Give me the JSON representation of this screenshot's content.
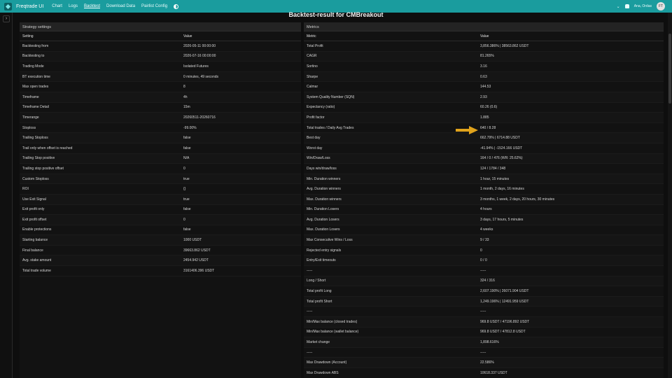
{
  "navbar": {
    "brand": "Freqtrade UI",
    "links": [
      "Chart",
      "Logs",
      "Backtest",
      "Download Data",
      "Pairlist Config"
    ],
    "active_index": 2,
    "user_name": "Ana, Ordas",
    "avatar_initials": "FT"
  },
  "page": {
    "title": "Backtest-result for CMBreakout"
  },
  "strategy": {
    "header": "Strategy settings",
    "col_setting": "Setting",
    "col_value": "Value",
    "rows": [
      [
        "Backtesting from",
        "2026-05-11 00:00:00"
      ],
      [
        "Backtesting to",
        "2026-07-16 00:00:00"
      ],
      [
        "Trading Mode",
        "Isolated Futures"
      ],
      [
        "BT execution time",
        "0 minutes, 49 seconds"
      ],
      [
        "Max open trades",
        "8"
      ],
      [
        "Timeframe",
        "4h"
      ],
      [
        "Timeframe Detail",
        "15m"
      ],
      [
        "Timerange",
        "20260511-20260716"
      ],
      [
        "Stoploss",
        "-99.00%"
      ],
      [
        "Trailing Stoploss",
        "false"
      ],
      [
        "Trail only when offset is reached",
        "false"
      ],
      [
        "Trailing Stop positive",
        "N/A"
      ],
      [
        "Trailing stop positive offset",
        "0"
      ],
      [
        "Custom Stoploss",
        "true"
      ],
      [
        "ROI",
        "{}"
      ],
      [
        "Use Exit Signal",
        "true"
      ],
      [
        "Exit profit only",
        "false"
      ],
      [
        "Exit profit offset",
        "0"
      ],
      [
        "Enable protections",
        "false"
      ],
      [
        "Starting balance",
        "1000 USDT"
      ],
      [
        "Final balance",
        "39663.862 USDT"
      ],
      [
        "Avg. stake amount",
        "2454.942 USDT"
      ],
      [
        "Total trade volume",
        "3161406.396 USDT"
      ]
    ]
  },
  "metrics": {
    "header": "Metrics",
    "col_metric": "Metric",
    "col_value": "Value",
    "rows": [
      [
        "Total Profit",
        "3,856.386% | 38563.862 USDT"
      ],
      [
        "CAGR",
        "81.265%"
      ],
      [
        "Sortino",
        "3.16"
      ],
      [
        "Sharpe",
        "0.63"
      ],
      [
        "Calmar",
        "144.53"
      ],
      [
        "System Quality Number (SQN)",
        "2.93"
      ],
      [
        "Expectancy (ratio)",
        "60.26 (0.6)"
      ],
      [
        "Profit factor",
        "1.885"
      ],
      [
        "Total trades / Daily Avg Trades",
        "640 / 8.28"
      ],
      [
        "Best day",
        "662.79% | 6714.88 USDT"
      ],
      [
        "Worst day",
        "-41.94% | -1524.166 USDT"
      ],
      [
        "Win/Draw/Loss",
        "164 / 0 / 476 (WR: 25.62%)"
      ],
      [
        "Days win/draw/loss",
        "124 / 1784 / 348"
      ],
      [
        "Min. Duration winners",
        "1 hour, 15 minutes"
      ],
      [
        "Avg. Duration winners",
        "1 month, 2 days, 16 minutes"
      ],
      [
        "Max. Duration winners",
        "3 months, 1 week, 2 days, 20 hours, 30 minutes"
      ],
      [
        "Min. Duration Losers",
        "4 hours"
      ],
      [
        "Avg. Duration Losers",
        "3 days, 17 hours, 5 minutes"
      ],
      [
        "Max. Duration Losers",
        "4 weeks"
      ],
      [
        "Max Consecutive Wins / Loss",
        "9 / 33"
      ],
      [
        "Rejected entry signals",
        "0"
      ],
      [
        "Entry/Exit timeouts",
        "0 / 0"
      ],
      [
        "-----",
        "-----"
      ],
      [
        "Long / Short",
        "324 / 316"
      ],
      [
        "Total profit Long",
        "2,607.190% | 26071.904 USDT"
      ],
      [
        "Total profit Short",
        "1,249.196% | 12491.959 USDT"
      ],
      [
        "-----",
        "-----"
      ],
      [
        "Min/Max balance (closed trades)",
        "969.8 USDT / 47196.892 USDT"
      ],
      [
        "Min/Max balance (wallet balance)",
        "969.8 USDT / 47812.8 USDT"
      ],
      [
        "Market change",
        "1,898.616%"
      ],
      [
        "-----",
        "-----"
      ],
      [
        "Max Drawdown (Account)",
        "22.586%"
      ],
      [
        "Max Drawdown ABS",
        "10618.337 USDT"
      ]
    ]
  },
  "colors": {
    "navbar": "#1a9c9e",
    "background": "#0e0e0e",
    "arrow": "#e0a31c"
  }
}
